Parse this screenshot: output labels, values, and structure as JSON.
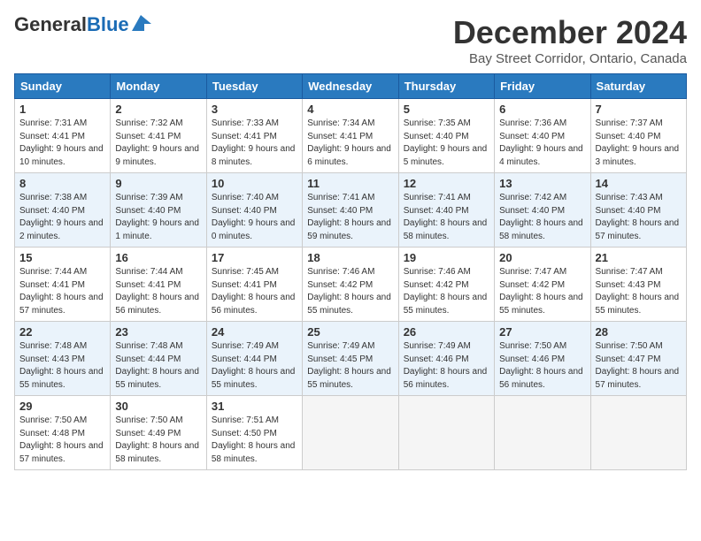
{
  "logo": {
    "general": "General",
    "blue": "Blue"
  },
  "title": "December 2024",
  "location": "Bay Street Corridor, Ontario, Canada",
  "weekdays": [
    "Sunday",
    "Monday",
    "Tuesday",
    "Wednesday",
    "Thursday",
    "Friday",
    "Saturday"
  ],
  "weeks": [
    [
      {
        "day": "1",
        "sunrise": "7:31 AM",
        "sunset": "4:41 PM",
        "daylight": "9 hours and 10 minutes."
      },
      {
        "day": "2",
        "sunrise": "7:32 AM",
        "sunset": "4:41 PM",
        "daylight": "9 hours and 9 minutes."
      },
      {
        "day": "3",
        "sunrise": "7:33 AM",
        "sunset": "4:41 PM",
        "daylight": "9 hours and 8 minutes."
      },
      {
        "day": "4",
        "sunrise": "7:34 AM",
        "sunset": "4:41 PM",
        "daylight": "9 hours and 6 minutes."
      },
      {
        "day": "5",
        "sunrise": "7:35 AM",
        "sunset": "4:40 PM",
        "daylight": "9 hours and 5 minutes."
      },
      {
        "day": "6",
        "sunrise": "7:36 AM",
        "sunset": "4:40 PM",
        "daylight": "9 hours and 4 minutes."
      },
      {
        "day": "7",
        "sunrise": "7:37 AM",
        "sunset": "4:40 PM",
        "daylight": "9 hours and 3 minutes."
      }
    ],
    [
      {
        "day": "8",
        "sunrise": "7:38 AM",
        "sunset": "4:40 PM",
        "daylight": "9 hours and 2 minutes."
      },
      {
        "day": "9",
        "sunrise": "7:39 AM",
        "sunset": "4:40 PM",
        "daylight": "9 hours and 1 minute."
      },
      {
        "day": "10",
        "sunrise": "7:40 AM",
        "sunset": "4:40 PM",
        "daylight": "9 hours and 0 minutes."
      },
      {
        "day": "11",
        "sunrise": "7:41 AM",
        "sunset": "4:40 PM",
        "daylight": "8 hours and 59 minutes."
      },
      {
        "day": "12",
        "sunrise": "7:41 AM",
        "sunset": "4:40 PM",
        "daylight": "8 hours and 58 minutes."
      },
      {
        "day": "13",
        "sunrise": "7:42 AM",
        "sunset": "4:40 PM",
        "daylight": "8 hours and 58 minutes."
      },
      {
        "day": "14",
        "sunrise": "7:43 AM",
        "sunset": "4:40 PM",
        "daylight": "8 hours and 57 minutes."
      }
    ],
    [
      {
        "day": "15",
        "sunrise": "7:44 AM",
        "sunset": "4:41 PM",
        "daylight": "8 hours and 57 minutes."
      },
      {
        "day": "16",
        "sunrise": "7:44 AM",
        "sunset": "4:41 PM",
        "daylight": "8 hours and 56 minutes."
      },
      {
        "day": "17",
        "sunrise": "7:45 AM",
        "sunset": "4:41 PM",
        "daylight": "8 hours and 56 minutes."
      },
      {
        "day": "18",
        "sunrise": "7:46 AM",
        "sunset": "4:42 PM",
        "daylight": "8 hours and 55 minutes."
      },
      {
        "day": "19",
        "sunrise": "7:46 AM",
        "sunset": "4:42 PM",
        "daylight": "8 hours and 55 minutes."
      },
      {
        "day": "20",
        "sunrise": "7:47 AM",
        "sunset": "4:42 PM",
        "daylight": "8 hours and 55 minutes."
      },
      {
        "day": "21",
        "sunrise": "7:47 AM",
        "sunset": "4:43 PM",
        "daylight": "8 hours and 55 minutes."
      }
    ],
    [
      {
        "day": "22",
        "sunrise": "7:48 AM",
        "sunset": "4:43 PM",
        "daylight": "8 hours and 55 minutes."
      },
      {
        "day": "23",
        "sunrise": "7:48 AM",
        "sunset": "4:44 PM",
        "daylight": "8 hours and 55 minutes."
      },
      {
        "day": "24",
        "sunrise": "7:49 AM",
        "sunset": "4:44 PM",
        "daylight": "8 hours and 55 minutes."
      },
      {
        "day": "25",
        "sunrise": "7:49 AM",
        "sunset": "4:45 PM",
        "daylight": "8 hours and 55 minutes."
      },
      {
        "day": "26",
        "sunrise": "7:49 AM",
        "sunset": "4:46 PM",
        "daylight": "8 hours and 56 minutes."
      },
      {
        "day": "27",
        "sunrise": "7:50 AM",
        "sunset": "4:46 PM",
        "daylight": "8 hours and 56 minutes."
      },
      {
        "day": "28",
        "sunrise": "7:50 AM",
        "sunset": "4:47 PM",
        "daylight": "8 hours and 57 minutes."
      }
    ],
    [
      {
        "day": "29",
        "sunrise": "7:50 AM",
        "sunset": "4:48 PM",
        "daylight": "8 hours and 57 minutes."
      },
      {
        "day": "30",
        "sunrise": "7:50 AM",
        "sunset": "4:49 PM",
        "daylight": "8 hours and 58 minutes."
      },
      {
        "day": "31",
        "sunrise": "7:51 AM",
        "sunset": "4:50 PM",
        "daylight": "8 hours and 58 minutes."
      },
      null,
      null,
      null,
      null
    ]
  ],
  "labels": {
    "sunrise": "Sunrise:",
    "sunset": "Sunset:",
    "daylight": "Daylight:"
  }
}
